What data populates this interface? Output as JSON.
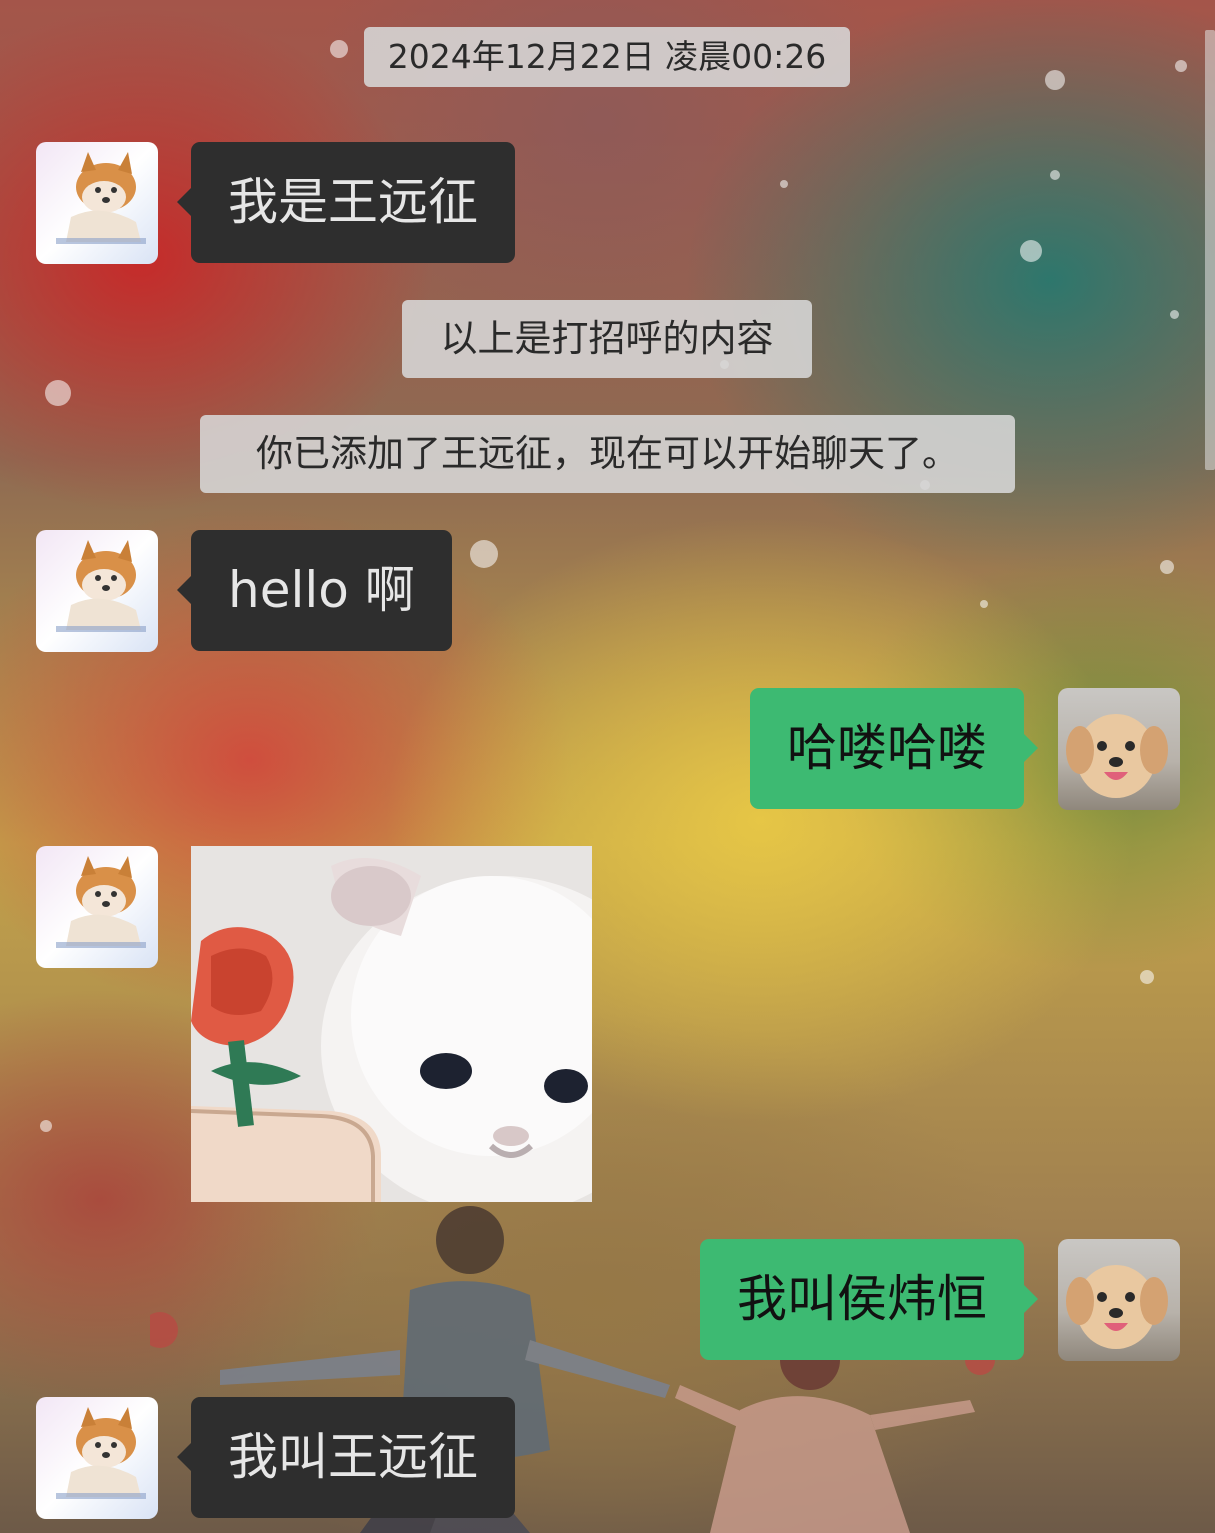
{
  "timestamp": "2024年12月22日 凌晨00:26",
  "system_notes": {
    "greeting_note": "以上是打招呼的内容",
    "added_note": "你已添加了王远征，现在可以开始聊天了。"
  },
  "messages": [
    {
      "sender": "contact",
      "text": "我是王远征"
    },
    {
      "sender": "contact",
      "text": "hello 啊"
    },
    {
      "sender": "me",
      "text": "哈喽哈喽"
    },
    {
      "sender": "contact",
      "type": "sticker",
      "description": "white-cat-with-rose"
    },
    {
      "sender": "me",
      "text": "我叫侯炜恒"
    },
    {
      "sender": "contact",
      "text": "我叫王远征"
    }
  ],
  "colors": {
    "incoming_bubble": "#2e2e2e",
    "outgoing_bubble": "#3dba72",
    "system_note_bg": "#d7d7d7"
  },
  "icons": {
    "contact_avatar": "shiba-dog-avatar",
    "my_avatar": "puppy-avatar"
  }
}
